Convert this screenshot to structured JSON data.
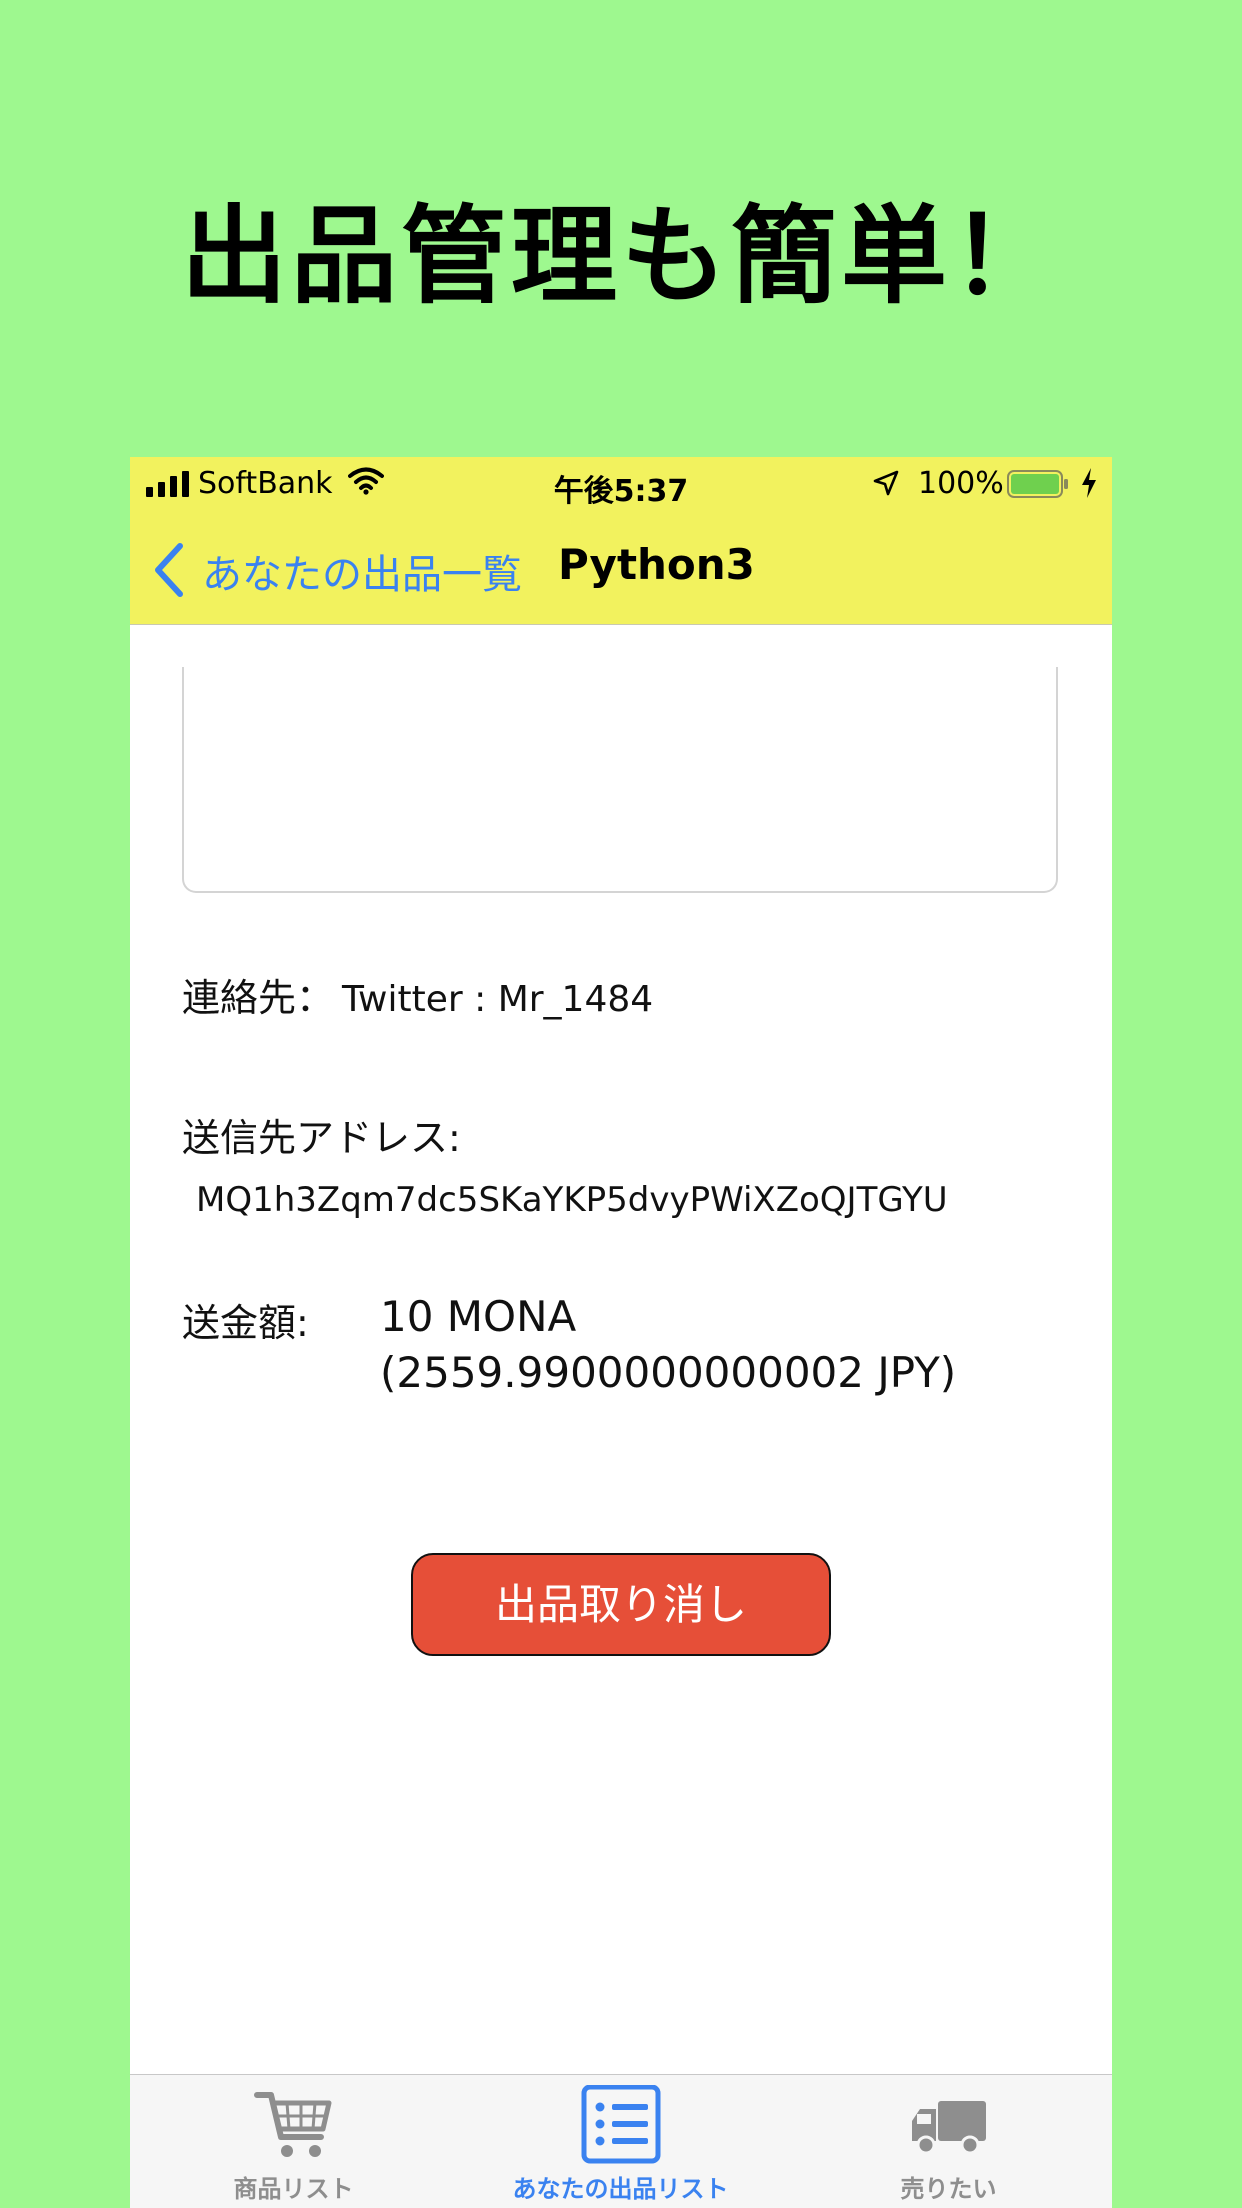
{
  "headline": "出品管理も簡単！",
  "status_bar": {
    "carrier": "SoftBank",
    "time": "午後5:37",
    "battery_percent": "100%",
    "battery_level": 1.0
  },
  "nav": {
    "back_label": "あなたの出品一覧",
    "title": "Python3"
  },
  "detail": {
    "contact_label": "連絡先：",
    "contact_value": "Twitter : Mr_1484",
    "address_label": "送信先アドレス:",
    "address_value": "MQ1h3Zqm7dc5SKaYKP5dvyPWiXZoQJTGYU",
    "amount_label": "送金額:",
    "amount_value": "10 MONA",
    "amount_jpy": "(2559.9900000000002 JPY)"
  },
  "cancel_button": {
    "label": "出品取り消し",
    "color": "#e64f38"
  },
  "tabs": [
    {
      "label": "商品リスト",
      "icon": "cart-icon",
      "active": false
    },
    {
      "label": "あなたの出品リスト",
      "icon": "list-icon",
      "active": true
    },
    {
      "label": "売りたい",
      "icon": "truck-icon",
      "active": false
    }
  ],
  "colors": {
    "background": "#9ef88f",
    "bar": "#f2f25e",
    "accent": "#3a82f0",
    "inactive_tab": "#8e8e8e"
  }
}
